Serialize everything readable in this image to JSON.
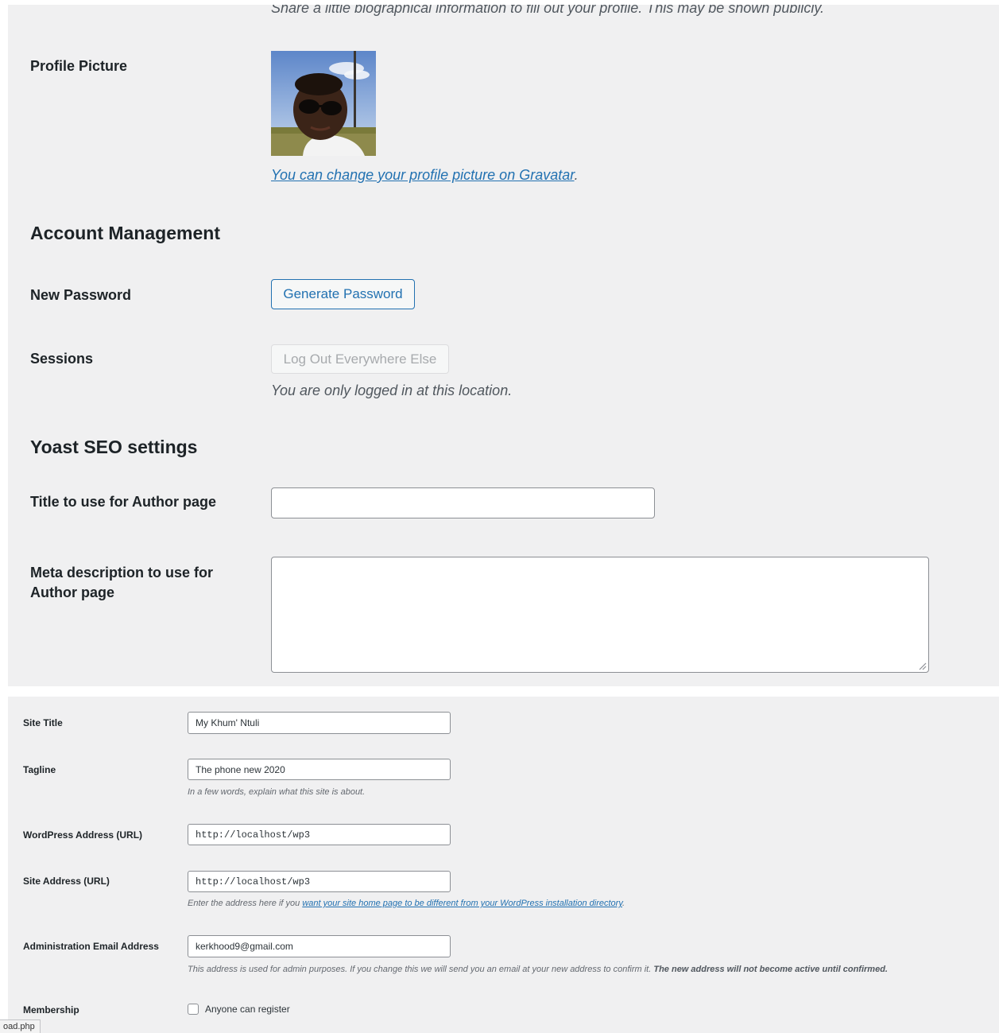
{
  "profile": {
    "bio_description": "Share a little biographical information to fill out your profile. This may be shown publicly.",
    "profile_picture_label": "Profile Picture",
    "gravatar_link": "You can change your profile picture on Gravatar",
    "gravatar_link_suffix": "."
  },
  "account_management": {
    "heading": "Account Management",
    "new_password_label": "New Password",
    "generate_password_button": "Generate Password",
    "sessions_label": "Sessions",
    "logout_everywhere_button": "Log Out Everywhere Else",
    "sessions_description": "You are only logged in at this location."
  },
  "yoast": {
    "heading": "Yoast SEO settings",
    "author_title_label": "Title to use for Author page",
    "author_title_value": "",
    "meta_description_label_line1": "Meta description to use for",
    "meta_description_label_line2": "Author page",
    "meta_description_value": ""
  },
  "general_settings": {
    "site_title_label": "Site Title",
    "site_title_value": "My Khum' Ntuli",
    "tagline_label": "Tagline",
    "tagline_value": "The phone new 2020",
    "tagline_description": "In a few words, explain what this site is about.",
    "wp_address_label": "WordPress Address (URL)",
    "wp_address_value": "http://localhost/wp3",
    "site_address_label": "Site Address (URL)",
    "site_address_value": "http://localhost/wp3",
    "site_address_description_prefix": "Enter the address here if you ",
    "site_address_description_link": "want your site home page to be different from your WordPress installation directory",
    "site_address_description_suffix": ".",
    "admin_email_label": "Administration Email Address",
    "admin_email_value": "kerkhood9@gmail.com",
    "admin_email_description": "This address is used for admin purposes. If you change this we will send you an email at your new address to confirm it.",
    "admin_email_description_bold": "The new address will not become active until confirmed.",
    "membership_label": "Membership",
    "membership_checkbox_label": "Anyone can register",
    "membership_checked": false
  },
  "status_bar": {
    "url_text": "oad.php"
  },
  "colors": {
    "panel_bg": "#f0f0f1",
    "link": "#2271b1",
    "text": "#1d2327",
    "description": "#50575e",
    "disabled": "#a7aaad"
  },
  "icons": {
    "resize": "textarea-resize-icon",
    "avatar": "profile-avatar-image"
  }
}
